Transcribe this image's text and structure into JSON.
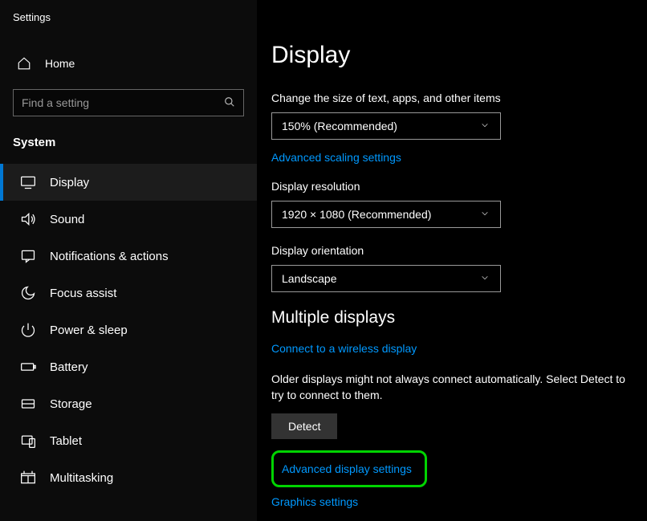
{
  "window_title": "Settings",
  "home_label": "Home",
  "search_placeholder": "Find a setting",
  "category_label": "System",
  "nav": [
    {
      "label": "Display",
      "icon": "display",
      "active": true
    },
    {
      "label": "Sound",
      "icon": "sound",
      "active": false
    },
    {
      "label": "Notifications & actions",
      "icon": "notifications",
      "active": false
    },
    {
      "label": "Focus assist",
      "icon": "focus",
      "active": false
    },
    {
      "label": "Power & sleep",
      "icon": "power",
      "active": false
    },
    {
      "label": "Battery",
      "icon": "battery",
      "active": false
    },
    {
      "label": "Storage",
      "icon": "storage",
      "active": false
    },
    {
      "label": "Tablet",
      "icon": "tablet",
      "active": false
    },
    {
      "label": "Multitasking",
      "icon": "multitasking",
      "active": false
    }
  ],
  "main": {
    "title": "Display",
    "scale_label": "Change the size of text, apps, and other items",
    "scale_value": "150% (Recommended)",
    "advanced_scaling_link": "Advanced scaling settings",
    "resolution_label": "Display resolution",
    "resolution_value": "1920 × 1080 (Recommended)",
    "orientation_label": "Display orientation",
    "orientation_value": "Landscape",
    "multiple_displays_heading": "Multiple displays",
    "connect_wireless_link": "Connect to a wireless display",
    "older_displays_text": "Older displays might not always connect automatically. Select Detect to try to connect to them.",
    "detect_button": "Detect",
    "advanced_display_link": "Advanced display settings",
    "graphics_settings_link": "Graphics settings"
  },
  "colors": {
    "accent": "#0078d4",
    "link": "#0099ff",
    "highlight": "#00d400"
  }
}
